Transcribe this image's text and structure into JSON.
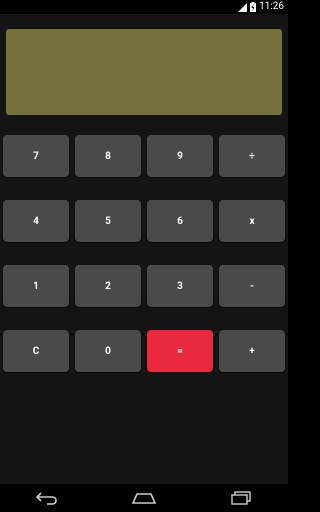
{
  "status_bar": {
    "time": "11:26",
    "icons": [
      "signal-icon",
      "battery-icon"
    ]
  },
  "display": {
    "value": "",
    "background_color": "#73713c"
  },
  "keys": {
    "row1": [
      "7",
      "8",
      "9",
      "÷"
    ],
    "row2": [
      "4",
      "5",
      "6",
      "x"
    ],
    "row3": [
      "1",
      "2",
      "3",
      "-"
    ],
    "row4": [
      "C",
      "0",
      "=",
      "+"
    ]
  },
  "colors": {
    "key_background": "#4a4a4a",
    "equals_background": "#e8293e",
    "app_background": "#141414"
  },
  "nav_bar": {
    "icons": [
      "back-icon",
      "home-icon",
      "recents-icon"
    ]
  }
}
